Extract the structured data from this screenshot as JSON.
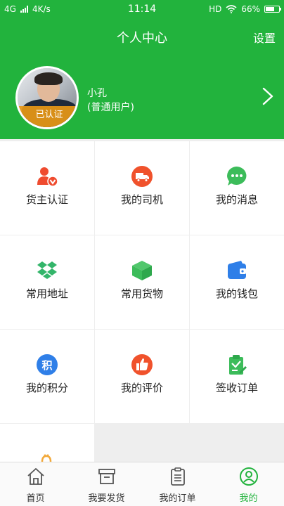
{
  "status_bar": {
    "network": "4G",
    "speed": "4K/s",
    "time": "11:14",
    "hd": "HD",
    "battery": "66%",
    "battery_level": 0.66
  },
  "header": {
    "title": "个人中心",
    "settings_label": "设置"
  },
  "profile": {
    "verified_badge": "已认证",
    "name": "小孔",
    "role": "(普通用户)"
  },
  "grid": {
    "items": [
      {
        "label": "货主认证",
        "icon": "shipper-verify-icon",
        "color": "#ef4b2f"
      },
      {
        "label": "我的司机",
        "icon": "truck-icon",
        "color": "#f0522c"
      },
      {
        "label": "我的消息",
        "icon": "chat-bubble-icon",
        "color": "#3cbc5a"
      },
      {
        "label": "常用地址",
        "icon": "dropbox-icon",
        "color": "#33b56a"
      },
      {
        "label": "常用货物",
        "icon": "cube-box-icon",
        "color": "#3cbc5a"
      },
      {
        "label": "我的钱包",
        "icon": "wallet-icon",
        "color": "#2f7fe8"
      },
      {
        "label": "我的积分",
        "icon": "points-icon",
        "color": "#2f7fe8"
      },
      {
        "label": "我的评价",
        "icon": "thumbs-up-icon",
        "color": "#f0522c"
      },
      {
        "label": "签收订单",
        "icon": "clipboard-sign-icon",
        "color": "#3cbc5a"
      }
    ]
  },
  "tabs": [
    {
      "label": "首页",
      "icon": "home-icon"
    },
    {
      "label": "我要发货",
      "icon": "box-icon"
    },
    {
      "label": "我的订单",
      "icon": "order-list-icon"
    },
    {
      "label": "我的",
      "icon": "profile-icon",
      "active": true
    }
  ],
  "colors": {
    "brand_green": "#22b33d",
    "verified_orange": "#e89816"
  }
}
